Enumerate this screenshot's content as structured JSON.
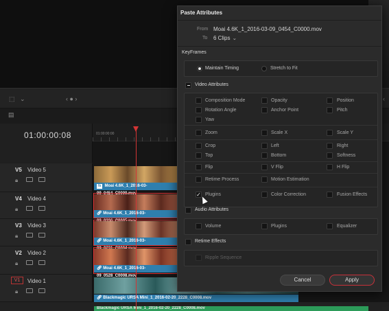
{
  "timeline": {
    "timecode": "01:00:00:08",
    "ruler_timecode": "01:00:00:00",
    "tracks": [
      {
        "id": "V5",
        "name": "Video 5",
        "clip": "Moai 4.6K_1_2016-03-09_0454_C0000.mov",
        "fx": "fx"
      },
      {
        "id": "V4",
        "name": "Video 4",
        "clip": "Moai 4.6K_1_2016-03-09_0336_C0005.mov"
      },
      {
        "id": "V3",
        "name": "Video 3",
        "clip": "Moai 4.6K_1_2016-03-09_0231_C0004.mov"
      },
      {
        "id": "V2",
        "name": "Video 2",
        "clip": "Moai 4.6K_1_2016-03-09_0528_C0008.mov"
      },
      {
        "id": "V1",
        "name": "Video 1",
        "clip": "Blackmagic URSA Mini_1_2016-02-20_2228_C0008.mov"
      }
    ],
    "bottom_clip": "Blackmagic URSA Mini_1_2016-02-20_2228_C0008.mov"
  },
  "dialog": {
    "title": "Paste Attributes",
    "from_label": "From",
    "from_value": "Moai 4.6K_1_2016-03-09_0454_C0000.mov",
    "to_label": "To",
    "to_value": "6 Clips",
    "keyframes_label": "KeyFrames",
    "keyframes_options": [
      "Maintain Timing",
      "Stretch to Fit"
    ],
    "video_attributes_label": "Video Attributes",
    "video_rows": [
      [
        "Composition Mode",
        "Opacity",
        "Position"
      ],
      [
        "Rotation Angle",
        "Anchor Point",
        "Pitch"
      ],
      [
        "Yaw",
        "",
        ""
      ],
      [
        "Zoom",
        "Scale X",
        "Scale Y"
      ],
      [
        "Crop",
        "Left",
        "Right"
      ],
      [
        "Top",
        "Bottom",
        "Softness"
      ],
      [
        "Flip",
        "V Flip",
        "H Flip"
      ],
      [
        "Retime Process",
        "Motion Estimation",
        ""
      ],
      [
        "Plugins",
        "Color Correction",
        "Fusion Effects"
      ]
    ],
    "audio_attributes_label": "Audio Attributes",
    "audio_items": [
      "Volume",
      "Plugins",
      "Equalizer"
    ],
    "retime_effects_label": "Retime Effects",
    "retime_items": [
      "Ripple Sequence"
    ],
    "cancel_label": "Cancel",
    "apply_label": "Apply"
  },
  "colors": {
    "accent_red": "#d43535",
    "clip_blue": "#2f7fae",
    "audio_green": "#2d9c5a"
  }
}
